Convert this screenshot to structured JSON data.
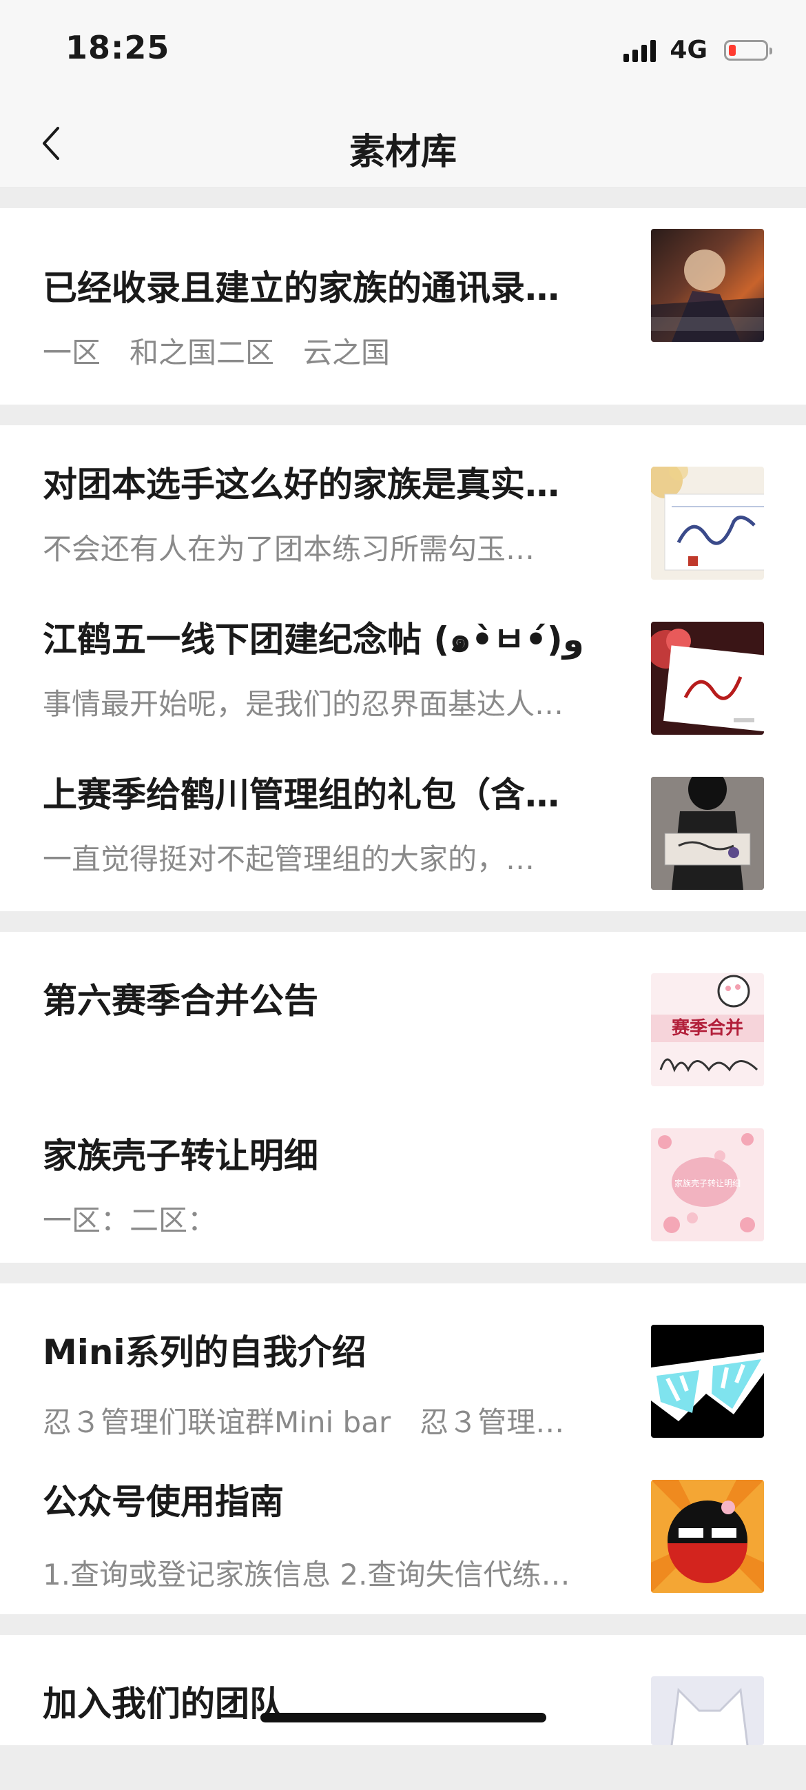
{
  "status_bar": {
    "time": "18:25",
    "network": "4G"
  },
  "nav": {
    "title": "素材库"
  },
  "groups": [
    {
      "items": [
        {
          "title": "已经收录且建立的家族的通讯录…",
          "desc": "一区　和之国二区　云之国",
          "thumb_icon": "anime-fighter-thumbnail"
        }
      ]
    },
    {
      "items": [
        {
          "title": "对团本选手这么好的家族是真实…",
          "desc": "不会还有人在为了团本练习所需勾玉…",
          "thumb_icon": "calligraphy-card-thumbnail"
        },
        {
          "title": "江鹤五一线下团建纪念帖 (๑•̀ㅂ•́)و",
          "desc": "事情最开始呢，是我们的忍界面基达人…",
          "thumb_icon": "red-calligraphy-thumbnail"
        },
        {
          "title": "上赛季给鹤川管理组的礼包（含…",
          "desc": "一直觉得挺对不起管理组的大家的，…",
          "thumb_icon": "gift-photo-thumbnail"
        }
      ]
    },
    {
      "items": [
        {
          "title": "第六赛季合并公告",
          "desc": "",
          "thumb_icon": "season-merge-thumbnail",
          "thumb_text": "赛季合并"
        },
        {
          "title": "家族壳子转让明细",
          "desc": "一区：二区：",
          "thumb_icon": "sakura-thumbnail",
          "thumb_text": "家族壳子转让明细"
        }
      ]
    },
    {
      "items": [
        {
          "title": "Mini系列的自我介绍",
          "desc": "忍３管理们联谊群Mini bar　忍３管理…",
          "thumb_icon": "sunglasses-thumbnail"
        },
        {
          "title": "公众号使用指南",
          "desc": "1.查询或登记家族信息 2.查询失信代练…",
          "thumb_icon": "ninja-mascot-thumbnail"
        }
      ]
    },
    {
      "items": [
        {
          "title": "加入我们的团队",
          "desc": "",
          "thumb_icon": "cat-outline-thumbnail"
        }
      ]
    }
  ],
  "colors": {
    "background": "#ededed",
    "card": "#ffffff",
    "title": "#1a1a1a",
    "desc": "#8a8a8a",
    "battery_low": "#ff3b30"
  }
}
